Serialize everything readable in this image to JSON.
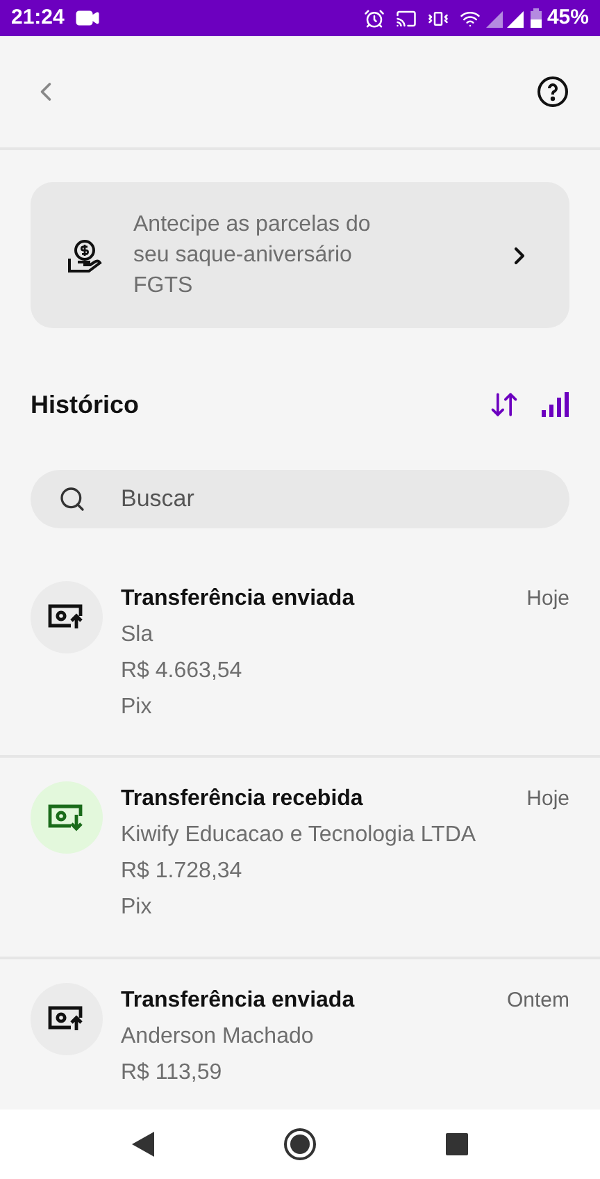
{
  "status_bar": {
    "time": "21:24",
    "battery": "45%"
  },
  "promo": {
    "text": "Antecipe as parcelas do seu saque-aniversário FGTS"
  },
  "history": {
    "title": "Histórico"
  },
  "search": {
    "placeholder": "Buscar"
  },
  "transactions": [
    {
      "kind": "sent",
      "title": "Transferência enviada",
      "date": "Hoje",
      "lines": [
        "Sla",
        "R$ 4.663,54",
        "Pix"
      ]
    },
    {
      "kind": "received",
      "title": "Transferência recebida",
      "date": "Hoje",
      "lines": [
        "Kiwify Educacao e Tecnologia LTDA",
        "R$ 1.728,34",
        "Pix"
      ]
    },
    {
      "kind": "sent",
      "title": "Transferência enviada",
      "date": "Ontem",
      "lines": [
        "Anderson Machado",
        "R$ 113,59"
      ]
    }
  ]
}
